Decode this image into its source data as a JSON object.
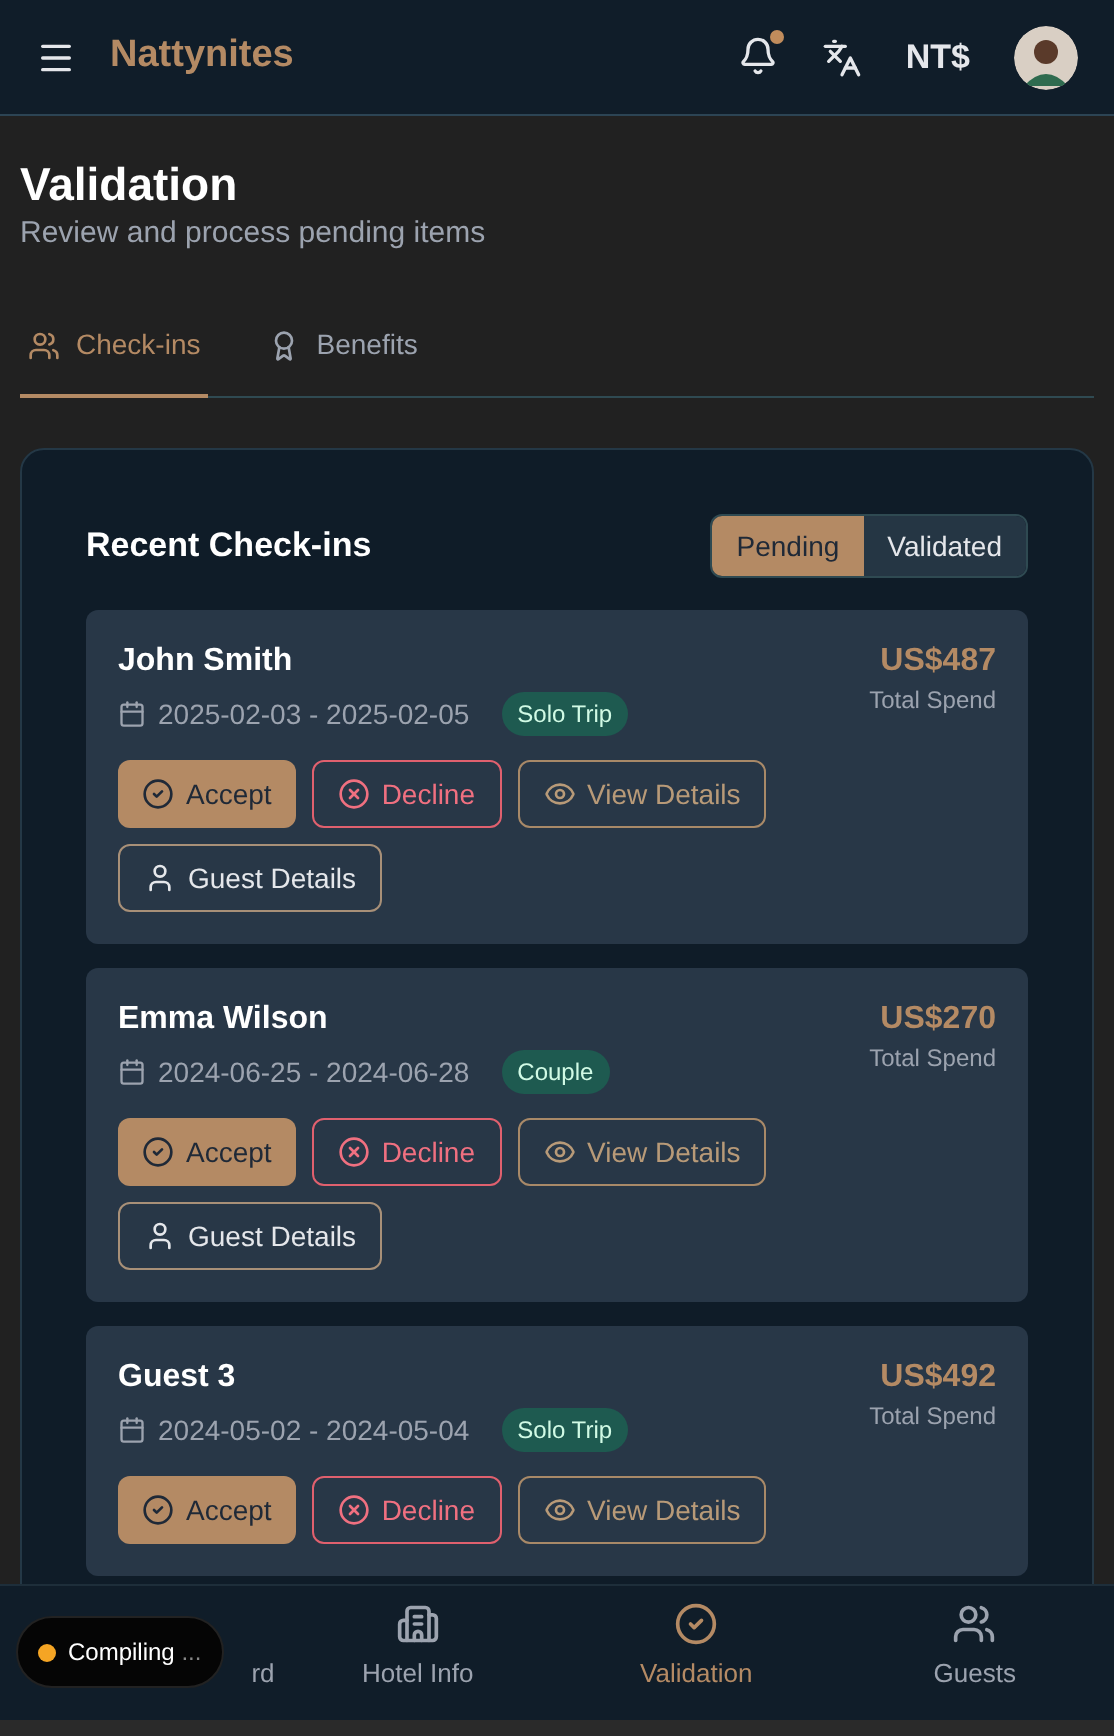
{
  "header": {
    "brand": "Nattynites",
    "notifications_unread": true,
    "currency": "NT$"
  },
  "page": {
    "title": "Validation",
    "subtitle": "Review and process pending items"
  },
  "tabs": [
    {
      "label": "Check-ins",
      "selected": true
    },
    {
      "label": "Benefits",
      "selected": false
    }
  ],
  "panel": {
    "title": "Recent Check-ins",
    "filters": [
      {
        "label": "Pending",
        "selected": true
      },
      {
        "label": "Validated",
        "selected": false
      }
    ]
  },
  "checkins": [
    {
      "name": "John Smith",
      "dates": "2025-02-03 - 2025-02-05",
      "tag": "Solo Trip",
      "amount": "US$487",
      "amount_label": "Total Spend",
      "actions": [
        {
          "kind": "accept",
          "label": "Accept"
        },
        {
          "kind": "decline",
          "label": "Decline"
        },
        {
          "kind": "view",
          "label": "View Details"
        },
        {
          "kind": "guest",
          "label": "Guest Details"
        }
      ]
    },
    {
      "name": "Emma Wilson",
      "dates": "2024-06-25 - 2024-06-28",
      "tag": "Couple",
      "amount": "US$270",
      "amount_label": "Total Spend",
      "actions": [
        {
          "kind": "accept",
          "label": "Accept"
        },
        {
          "kind": "decline",
          "label": "Decline"
        },
        {
          "kind": "view",
          "label": "View Details"
        },
        {
          "kind": "guest",
          "label": "Guest Details"
        }
      ]
    },
    {
      "name": "Guest 3",
      "dates": "2024-05-02 - 2024-05-04",
      "tag": "Solo Trip",
      "amount": "US$492",
      "amount_label": "Total Spend",
      "actions": [
        {
          "kind": "accept",
          "label": "Accept"
        },
        {
          "kind": "decline",
          "label": "Decline"
        },
        {
          "kind": "view",
          "label": "View Details"
        }
      ]
    }
  ],
  "bottom_nav": [
    {
      "label": "rd",
      "selected": false
    },
    {
      "label": "Hotel Info",
      "selected": false
    },
    {
      "label": "Validation",
      "selected": true
    },
    {
      "label": "Guests",
      "selected": false
    }
  ],
  "toast": {
    "text": "Compiling",
    "ellipsis": "..."
  }
}
